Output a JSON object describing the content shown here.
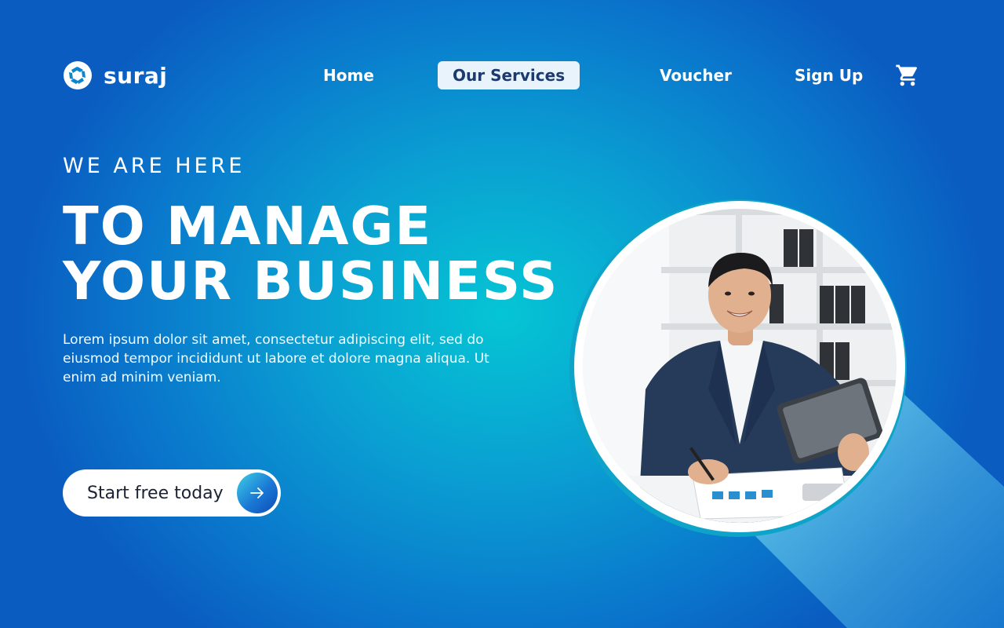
{
  "brand": {
    "name": "suraj",
    "logo_icon": "aperture-icon"
  },
  "nav": {
    "items": [
      {
        "label": "Home",
        "active": false
      },
      {
        "label": "Our Services",
        "active": true
      },
      {
        "label": "Voucher",
        "active": false
      },
      {
        "label": "Sign Up",
        "active": false
      }
    ],
    "cart_icon": "shopping-cart-icon"
  },
  "hero": {
    "eyebrow": "WE ARE HERE",
    "headline_line1": "TO MANAGE",
    "headline_line2": "YOUR BUSINESS",
    "body": "Lorem ipsum dolor sit amet, consectetur adipiscing elit, sed do eiusmod tempor incididunt ut labore et dolore magna aliqua. Ut enim ad minim veniam.",
    "cta_label": "Start free today",
    "cta_icon": "arrow-right-icon"
  },
  "colors": {
    "accent_light": "#e9f3fb",
    "accent_dark": "#1c3a6e",
    "bg_center": "#05c5d4",
    "bg_edge": "#0a5cc0"
  }
}
